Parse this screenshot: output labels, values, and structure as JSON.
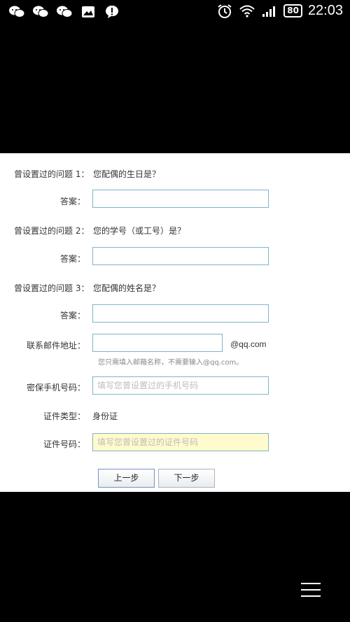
{
  "status_bar": {
    "time": "22:03",
    "battery": "80",
    "left_icons": [
      "wechat-icon",
      "wechat-icon",
      "wechat-icon",
      "image-icon",
      "chat-alert-icon"
    ],
    "right_icons": [
      "alarm-icon",
      "wifi-icon",
      "signal-icon",
      "battery-icon"
    ]
  },
  "form": {
    "q1": {
      "label": "曾设置过的问题 1：",
      "question": "您配偶的生日是？",
      "answer_label": "答案：",
      "answer_value": ""
    },
    "q2": {
      "label": "曾设置过的问题 2：",
      "question": "您的学号（或工号）是？",
      "answer_label": "答案：",
      "answer_value": ""
    },
    "q3": {
      "label": "曾设置过的问题 3：",
      "question": "您配偶的姓名是？",
      "answer_label": "答案：",
      "answer_value": ""
    },
    "email": {
      "label": "联系邮件地址：",
      "value": "",
      "suffix": "@qq.com",
      "hint": "您只需填入邮箱名称，不需要输入@qq.com。"
    },
    "phone": {
      "label": "密保手机号码：",
      "placeholder": "填写您曾设置过的手机号码"
    },
    "id_type": {
      "label": "证件类型：",
      "value": "身份证"
    },
    "id_number": {
      "label": "证件号码：",
      "placeholder": "填写您曾设置过的证件号码"
    },
    "buttons": {
      "prev": "上一步",
      "next": "下一步"
    }
  },
  "colors": {
    "field_border": "#7fb4c9",
    "id_field_bg": "#fffbcc",
    "background": "#000000",
    "panel": "#ffffff"
  }
}
